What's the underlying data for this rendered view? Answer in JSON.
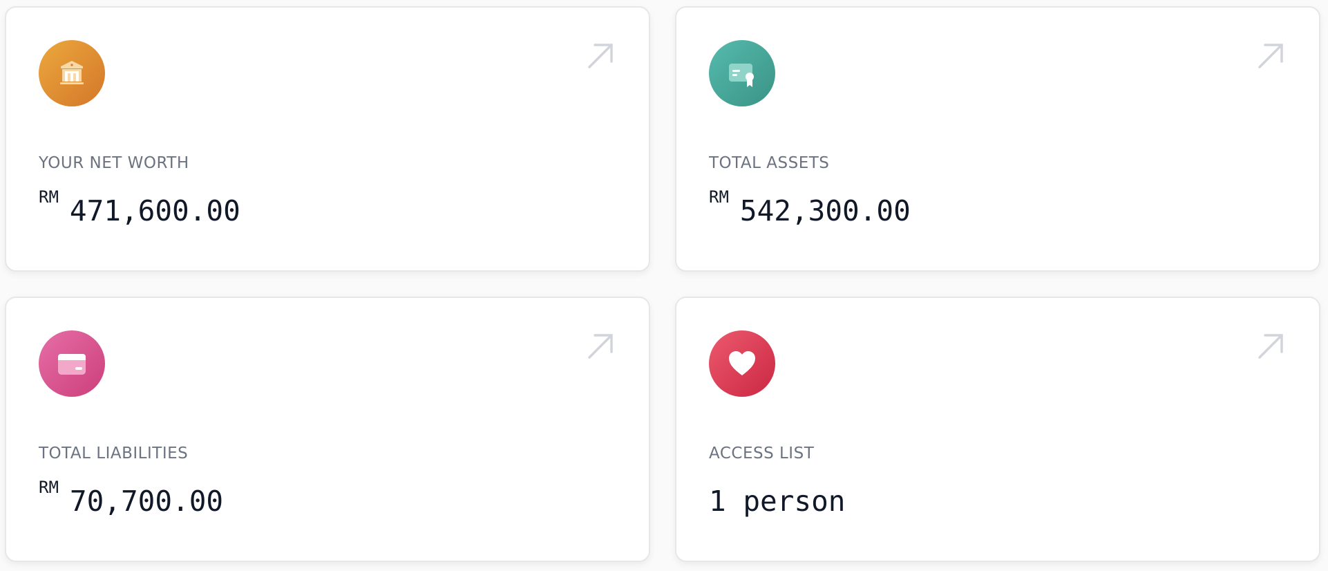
{
  "cards": [
    {
      "label": "YOUR NET WORTH",
      "currency": "RM",
      "value": "471,600.00",
      "icon": "bank-icon",
      "color": [
        "#e9a23a",
        "#d97a26"
      ]
    },
    {
      "label": "TOTAL ASSETS",
      "currency": "RM",
      "value": "542,300.00",
      "icon": "certificate-icon",
      "color": [
        "#4db6a8",
        "#3d9688"
      ]
    },
    {
      "label": "TOTAL LIABILITIES",
      "currency": "RM",
      "value": "70,700.00",
      "icon": "credit-card-icon",
      "color": [
        "#e568a0",
        "#d0437f"
      ]
    },
    {
      "label": "ACCESS LIST",
      "value": "1 person",
      "icon": "heart-icon",
      "color": [
        "#ea5468",
        "#cf2a45"
      ]
    }
  ],
  "arrow_icon": "arrow-up-right-icon",
  "colors": {
    "label": "#6b7280",
    "value": "#111827",
    "arrow": "#d1d5db",
    "card_border": "#e5e7eb"
  }
}
